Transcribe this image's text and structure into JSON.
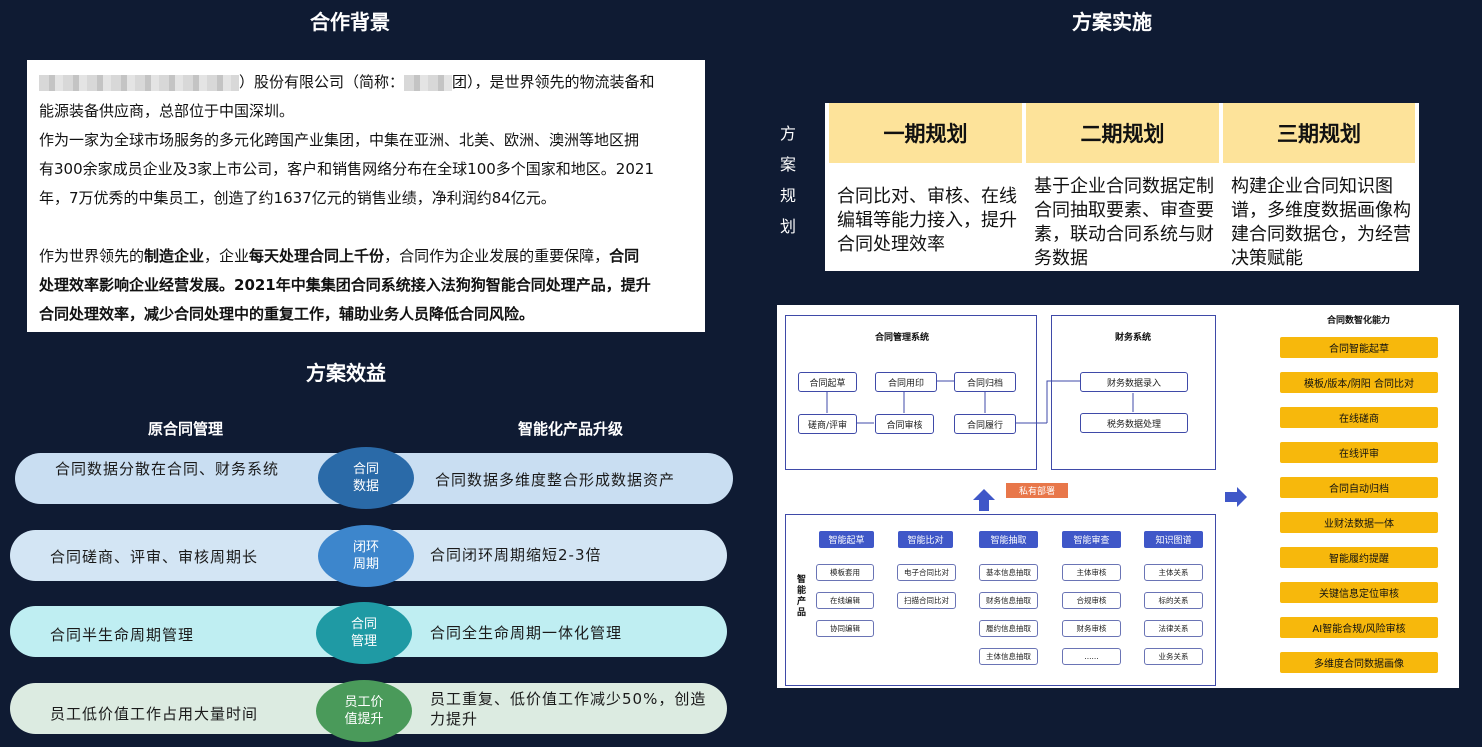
{
  "titles": {
    "background": "合作背景",
    "implementation": "方案实施",
    "benefits": "方案效益"
  },
  "background": {
    "line1": "）股份有限公司（简称：",
    "line1b": "团），是世界领先的物流装备和",
    "line2": "能源装备供应商，总部位于中国深圳。",
    "line3": "作为一家为全球市场服务的多元化跨国产业集团，中集在亚洲、北美、欧洲、澳洲等地区拥",
    "line4": "有300余家成员企业及3家上市公司，客户和销售网络分布在全球100多个国家和地区。2021",
    "line5": "年，7万优秀的中集员工，创造了约1637亿元的销售业绩，净利润约84亿元。",
    "p2_a": "作为世界领先的",
    "p2_b": "制造企业",
    "p2_c": "，企业",
    "p2_d": "每天处理合同上千份",
    "p2_e": "，合同作为企业发展的重要保障，",
    "p2_f": "合同",
    "p2_line2": "处理效率影响企业经营发展。2021年中集集团合同系统接入法狗狗智能合同处理产品，提升",
    "p2_line3": "合同处理效率，减少合同处理中的重复工作，辅助业务人员降低合同风险。"
  },
  "benefits": {
    "col_left": "原合同管理",
    "col_right": "智能化产品升级",
    "rows": [
      {
        "left": "合同数据分散在合同、财务系统",
        "center": "合同数据",
        "right": "合同数据多维度整合形成数据资产"
      },
      {
        "left": "合同磋商、评审、审核周期长",
        "center": "闭环周期",
        "right": "合同闭环周期缩短2-3倍"
      },
      {
        "left": "合同半生命周期管理",
        "center": "合同管理",
        "right": "合同全生命周期一体化管理"
      },
      {
        "left": "员工低价值工作占用大量时间",
        "center": "员工价值提升",
        "right": "员工重复、低价值工作减少50%，创造力提升"
      }
    ],
    "colors": {
      "pill1": "#c9def2",
      "pill2": "#d3e5f4",
      "pill3": "#bfeef2",
      "pill4": "#dcebe1",
      "c1": "#2a6aa8",
      "c2": "#3d86cc",
      "c3": "#1f9aa4",
      "c4": "#4a9a5a"
    }
  },
  "plan": {
    "vertical_label": [
      "方",
      "案",
      "规",
      "划"
    ],
    "phases": [
      {
        "title": "一期规划",
        "body": "合同比对、审核、在线编辑等能力接入，提升合同处理效率"
      },
      {
        "title": "二期规划",
        "body": "基于企业合同数据定制合同抽取要素、审查要素，联动合同系统与财务数据"
      },
      {
        "title": "三期规划",
        "body": "构建企业合同知识图谱，多维度数据画像构建合同数据仓，为经营决策赋能"
      }
    ]
  },
  "diagram": {
    "contract_system": "合同管理系统",
    "finance_system": "财务系统",
    "capability_title": "合同数智化能力",
    "nodes": [
      "合同起草",
      "合同用印",
      "合同归档",
      "磋商/评审",
      "合同审核",
      "合同履行"
    ],
    "finance_nodes": [
      "财务数据录入",
      "税务数据处理"
    ],
    "private_deploy": "私有部署",
    "smart_product": "智能产品",
    "product_heads": [
      "智能起草",
      "智能比对",
      "智能抽取",
      "智能审查",
      "知识图谱"
    ],
    "product_items": [
      [
        "模板套用",
        "在线编辑",
        "协同编辑"
      ],
      [
        "电子合同比对",
        "扫描合同比对"
      ],
      [
        "基本信息抽取",
        "财务信息抽取",
        "履约信息抽取",
        "主体信息抽取"
      ],
      [
        "主体审核",
        "合规审核",
        "财务审核",
        "......"
      ],
      [
        "主体关系",
        "标的关系",
        "法律关系",
        "业务关系"
      ]
    ],
    "capabilities": [
      "合同智能起草",
      "模板/版本/阴阳 合同比对",
      "在线磋商",
      "在线评审",
      "合同自动归档",
      "业财法数据一体",
      "智能履约提醒",
      "关键信息定位审核",
      "AI智能合规/风险审核",
      "多维度合同数据画像"
    ]
  }
}
